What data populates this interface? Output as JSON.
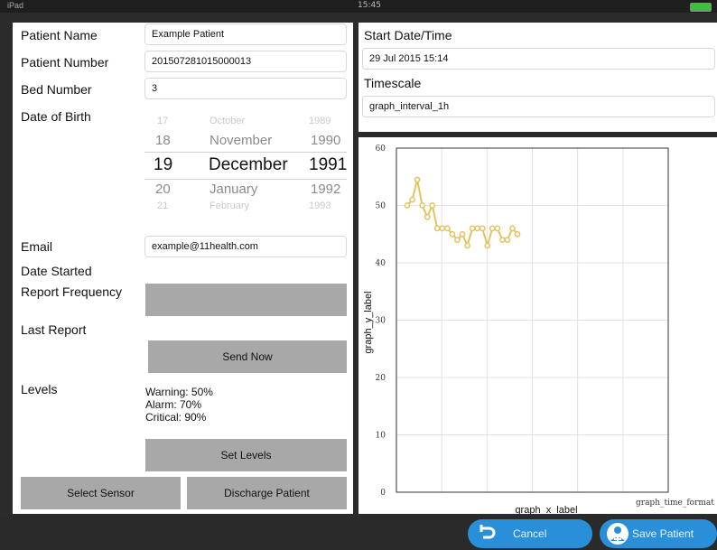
{
  "statusbar": {
    "time": "15:45",
    "signal": "iPad",
    "battery_level": 1.0
  },
  "form": {
    "patient_name": {
      "label": "Patient Name",
      "value": "Example Patient"
    },
    "patient_number": {
      "label": "Patient Number",
      "value": "201507281015000013"
    },
    "bed_number": {
      "label": "Bed Number",
      "value": "3"
    },
    "dob": {
      "label": "Date of Birth",
      "picker_rows": [
        {
          "day": "17",
          "month": "October",
          "year": "1989"
        },
        {
          "day": "18",
          "month": "November",
          "year": "1990"
        },
        {
          "day": "19",
          "month": "December",
          "year": "1991"
        },
        {
          "day": "20",
          "month": "January",
          "year": "1992"
        },
        {
          "day": "21",
          "month": "February",
          "year": "1993"
        }
      ]
    },
    "email": {
      "label": "Email",
      "value": "example@11health.com"
    },
    "date_started_label": "Date Started",
    "report_frequency_label": "Report Frequency",
    "last_report_label": "Last Report",
    "send_now_label": "Send Now",
    "levels_label": "Levels",
    "warning": "Warning: 50%",
    "alarm": "Alarm: 70%",
    "critical": "Critical: 90%",
    "set_levels_label": "Set Levels",
    "select_sensor_label": "Select Sensor",
    "discharge_label": "Discharge Patient"
  },
  "schedule": {
    "start_label": "Start Date/Time",
    "start_value": "29 Jul 2015 15:14",
    "timescale_label": "Timescale",
    "timescale_value": "graph_interval_1h"
  },
  "chart_data": {
    "type": "line",
    "xlabel": "graph_x_label",
    "ylabel": "graph_y_label",
    "time_format_label": "graph_time_format",
    "ylim": [
      0,
      60
    ],
    "yticks": [
      0,
      10,
      20,
      30,
      40,
      50,
      60
    ],
    "grid": true,
    "line_color": "#e3c35d",
    "series": [
      {
        "values": [
          50,
          51,
          54.5,
          50,
          48,
          50,
          46,
          46,
          46,
          45,
          44,
          45,
          43,
          46,
          46,
          46,
          43,
          46,
          46,
          44,
          44,
          46,
          45
        ]
      }
    ]
  },
  "footer": {
    "cancel_label": "Cancel",
    "save_label": "Save Patient",
    "accent": "#2a8fd9"
  }
}
